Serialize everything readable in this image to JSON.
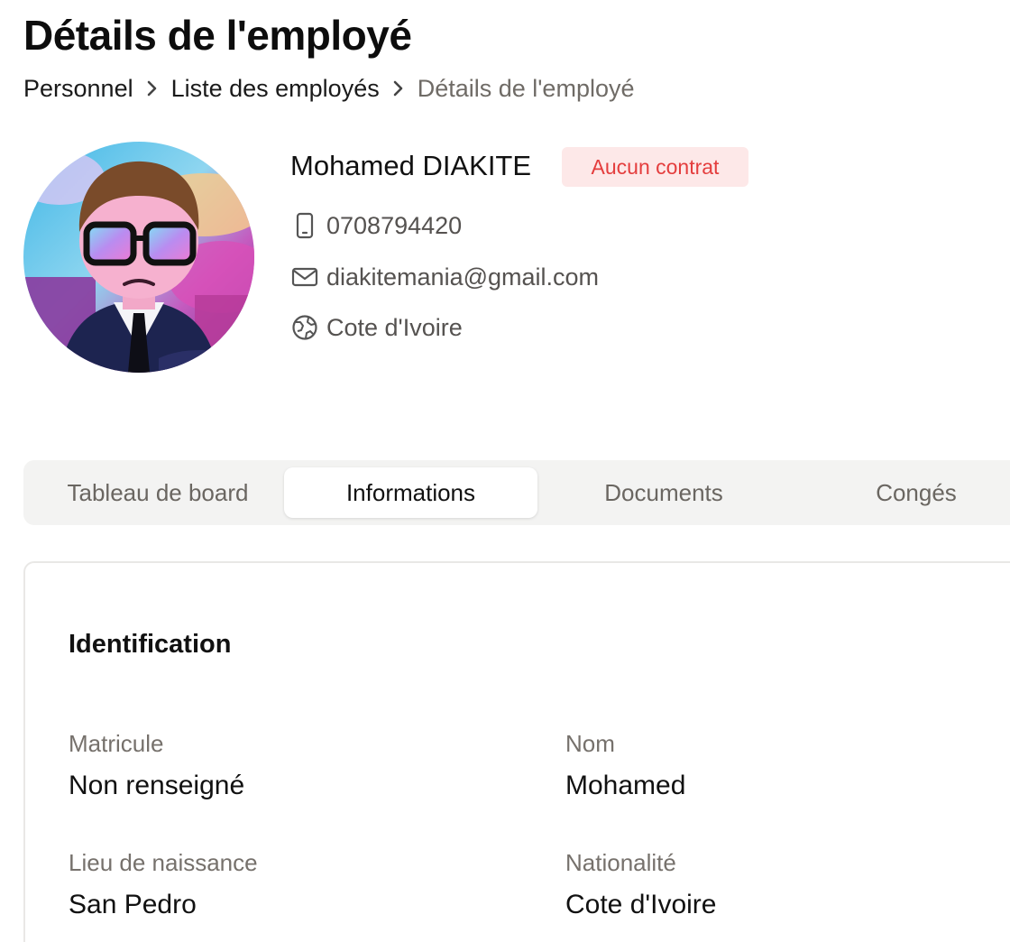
{
  "page": {
    "title": "Détails de l'employé"
  },
  "breadcrumb": {
    "items": [
      {
        "label": "Personnel"
      },
      {
        "label": "Liste des employés"
      },
      {
        "label": "Détails de l'employé"
      }
    ]
  },
  "profile": {
    "name": "Mohamed DIAKITE",
    "contract_status": "Aucun contrat",
    "phone": "0708794420",
    "email": "diakitemania@gmail.com",
    "country": "Cote d'Ivoire",
    "icons": {
      "phone": "phone-icon",
      "email": "mail-icon",
      "country": "globe-icon"
    }
  },
  "tabs": [
    {
      "label": "Tableau de board",
      "active": false
    },
    {
      "label": "Informations",
      "active": true
    },
    {
      "label": "Documents",
      "active": false
    },
    {
      "label": "Congés",
      "active": false
    }
  ],
  "identification": {
    "title": "Identification",
    "fields": [
      {
        "label": "Matricule",
        "value": "Non renseigné"
      },
      {
        "label": "Nom",
        "value": "Mohamed"
      },
      {
        "label": "Lieu de naissance",
        "value": "San Pedro"
      },
      {
        "label": "Nationalité",
        "value": "Cote d'Ivoire"
      }
    ]
  },
  "colors": {
    "badge_bg": "#fde8e8",
    "badge_text": "#e43d3d",
    "tab_bar_bg": "#f3f3f2",
    "muted_text": "#76716c"
  }
}
